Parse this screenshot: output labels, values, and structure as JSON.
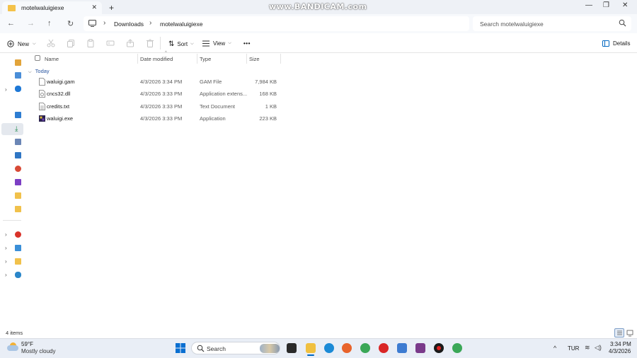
{
  "window": {
    "tab_title": "motelwaluigiexe",
    "tab_close": "✕",
    "new_tab": "+",
    "watermark": "www.BANDICAM.com",
    "minimize": "—",
    "maximize": "❐",
    "close": "✕"
  },
  "address": {
    "segments": [
      "Downloads",
      "motelwaluigiexe"
    ],
    "separator": "›",
    "search_placeholder": "Search motelwaluigiexe"
  },
  "toolbar": {
    "new_label": "New",
    "sort_label": "Sort",
    "view_label": "View",
    "more_label": "•••",
    "details_label": "Details"
  },
  "columns": {
    "name": "Name",
    "date": "Date modified",
    "type": "Type",
    "size": "Size"
  },
  "group": {
    "label": "Today"
  },
  "files": [
    {
      "name": "waluigi.gam",
      "date": "4/3/2026 3:34 PM",
      "type": "GAM File",
      "size": "7,984 KB",
      "icon": "blank-file-icon"
    },
    {
      "name": "cncs32.dll",
      "date": "4/3/2026 3:33 PM",
      "type": "Application extens...",
      "size": "168 KB",
      "icon": "dll-file-icon"
    },
    {
      "name": "credits.txt",
      "date": "4/3/2026 3:33 PM",
      "type": "Text Document",
      "size": "1 KB",
      "icon": "text-file-icon"
    },
    {
      "name": "waluigi.exe",
      "date": "4/3/2026 3:33 PM",
      "type": "Application",
      "size": "223 KB",
      "icon": "exe-app-icon"
    }
  ],
  "status": {
    "item_count": "4 items"
  },
  "taskbar": {
    "weather_temp": "59°F",
    "weather_desc": "Mostly cloudy",
    "search_label": "Search",
    "language": "TUR",
    "time": "3:34 PM",
    "date": "4/3/2026"
  },
  "colors": {
    "accent": "#0067c0",
    "selection": "#e4e8ee",
    "taskbar": "#e9eef6"
  }
}
